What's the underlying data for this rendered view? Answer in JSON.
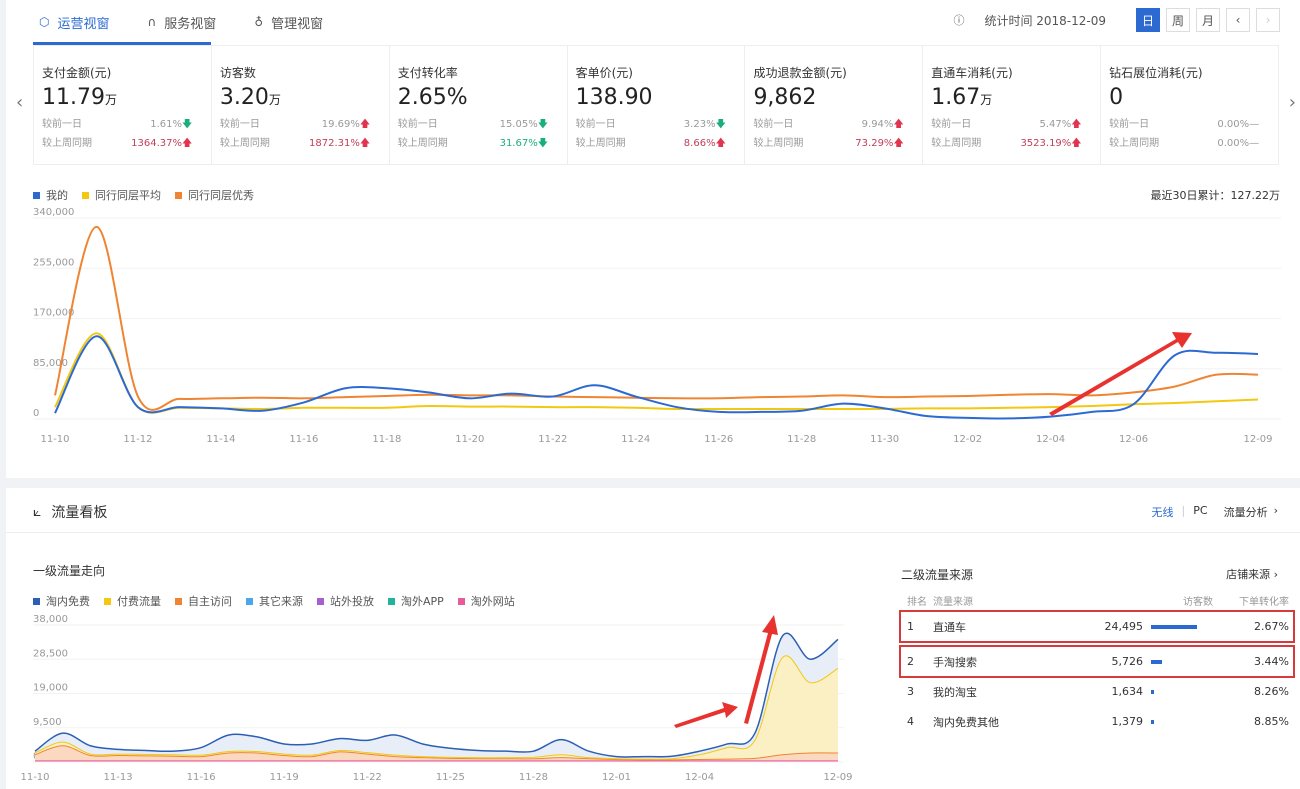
{
  "tabs": [
    {
      "label": "运营视窗",
      "icon": "shield-icon",
      "active": true
    },
    {
      "label": "服务视窗",
      "icon": "headset-icon"
    },
    {
      "label": "管理视窗",
      "icon": "medal-icon"
    }
  ],
  "header": {
    "stat_time": "统计时间 2018-12-09",
    "periods": [
      "日",
      "周",
      "月"
    ],
    "active_period": "日"
  },
  "kpis": [
    {
      "title": "支付金额(元)",
      "value": "11.79",
      "unit": "万",
      "d_label": "较前一日",
      "d_val": "1.61%",
      "d_dir": "down",
      "w_label": "较上周同期",
      "w_val": "1364.37%",
      "w_dir": "up"
    },
    {
      "title": "访客数",
      "value": "3.20",
      "unit": "万",
      "d_label": "较前一日",
      "d_val": "19.69%",
      "d_dir": "up",
      "w_label": "较上周同期",
      "w_val": "1872.31%",
      "w_dir": "up"
    },
    {
      "title": "支付转化率",
      "value": "2.65%",
      "unit": "",
      "d_label": "较前一日",
      "d_val": "15.05%",
      "d_dir": "down",
      "w_label": "较上周同期",
      "w_val": "31.67%",
      "w_dir": "down"
    },
    {
      "title": "客单价(元)",
      "value": "138.90",
      "unit": "",
      "d_label": "较前一日",
      "d_val": "3.23%",
      "d_dir": "down",
      "w_label": "较上周同期",
      "w_val": "8.66%",
      "w_dir": "up"
    },
    {
      "title": "成功退款金额(元)",
      "value": "9,862",
      "unit": "",
      "d_label": "较前一日",
      "d_val": "9.94%",
      "d_dir": "up",
      "w_label": "较上周同期",
      "w_val": "73.29%",
      "w_dir": "up"
    },
    {
      "title": "直通车消耗(元)",
      "value": "1.67",
      "unit": "万",
      "d_label": "较前一日",
      "d_val": "5.47%",
      "d_dir": "up",
      "w_label": "较上周同期",
      "w_val": "3523.19%",
      "w_dir": "up"
    },
    {
      "title": "钻石展位消耗(元)",
      "value": "0",
      "unit": "",
      "d_label": "较前一日",
      "d_val": "0.00%",
      "d_dir": "flat",
      "w_label": "较上周同期",
      "w_val": "0.00%",
      "w_dir": "flat"
    }
  ],
  "colors": {
    "accent": "#2c6ad2",
    "up": "#e0344f",
    "down": "#1aae7a",
    "annotation": "#e8322f"
  },
  "traffic": {
    "title": "流量看板",
    "links": [
      "无线",
      "PC",
      "流量分析"
    ],
    "active_link": "无线",
    "sub_left": "一级流量走向",
    "sub_right": "二级流量来源",
    "store_link": "店铺来源",
    "table_headers": [
      "排名",
      "流量来源",
      "访客数",
      "下单转化率"
    ],
    "rows": [
      {
        "rank": "1",
        "source": "直通车",
        "visitors": "24,495",
        "visitors_num": 24495,
        "rate": "2.67%",
        "highlighted": true
      },
      {
        "rank": "2",
        "source": "手淘搜索",
        "visitors": "5,726",
        "visitors_num": 5726,
        "rate": "3.44%",
        "highlighted": true
      },
      {
        "rank": "3",
        "source": "我的淘宝",
        "visitors": "1,634",
        "visitors_num": 1634,
        "rate": "8.26%"
      },
      {
        "rank": "4",
        "source": "淘内免费其他",
        "visitors": "1,379",
        "visitors_num": 1379,
        "rate": "8.85%"
      }
    ]
  },
  "chart_data": [
    {
      "type": "line",
      "total_label": "最近30日累计：127.22万",
      "ylim": [
        0,
        340000
      ],
      "yticks": [
        "0",
        "85,000",
        "170,000",
        "255,000",
        "340,000"
      ],
      "xticks": [
        "11-10",
        "11-12",
        "11-14",
        "11-16",
        "11-18",
        "11-20",
        "11-22",
        "11-24",
        "11-26",
        "11-28",
        "11-30",
        "12-02",
        "12-04",
        "12-06",
        "12-09"
      ],
      "x": [
        "11-10",
        "11-11",
        "11-12",
        "11-13",
        "11-14",
        "11-15",
        "11-16",
        "11-17",
        "11-18",
        "11-19",
        "11-20",
        "11-21",
        "11-22",
        "11-23",
        "11-24",
        "11-25",
        "11-26",
        "11-27",
        "11-28",
        "11-29",
        "11-30",
        "12-01",
        "12-02",
        "12-03",
        "12-04",
        "12-05",
        "12-06",
        "12-07",
        "12-08",
        "12-09"
      ],
      "series": [
        {
          "name": "我的",
          "color": "#2c6ad2",
          "values": [
            10000,
            140000,
            20000,
            20000,
            18000,
            14000,
            28000,
            52000,
            52000,
            45000,
            35000,
            43000,
            38000,
            57000,
            38000,
            20000,
            12000,
            12000,
            14000,
            26000,
            18000,
            5000,
            2000,
            1000,
            4000,
            12000,
            25000,
            108000,
            112000,
            110000
          ]
        },
        {
          "name": "同行同层平均",
          "color": "#f2c811",
          "values": [
            20000,
            145000,
            20000,
            19000,
            18000,
            17000,
            19000,
            19000,
            19000,
            22000,
            21000,
            21000,
            20000,
            20000,
            19000,
            17000,
            17000,
            17000,
            17000,
            17000,
            17000,
            18000,
            18000,
            19000,
            20000,
            22000,
            25000,
            27000,
            30000,
            33000
          ]
        },
        {
          "name": "同行同层优秀",
          "color": "#ef8533",
          "values": [
            40000,
            325000,
            38000,
            34000,
            35000,
            36000,
            35000,
            37000,
            39000,
            41000,
            40000,
            40000,
            38000,
            37000,
            36000,
            35000,
            35000,
            37000,
            38000,
            40000,
            37000,
            38000,
            39000,
            41000,
            42000,
            40000,
            45000,
            55000,
            75000,
            75000
          ]
        }
      ]
    },
    {
      "type": "area",
      "stacked": true,
      "title": "一级流量走向",
      "ylim": [
        0,
        38000
      ],
      "yticks": [
        "0",
        "9,500",
        "19,000",
        "28,500",
        "38,000"
      ],
      "xticks": [
        "11-10",
        "11-13",
        "11-16",
        "11-19",
        "11-22",
        "11-25",
        "11-28",
        "12-01",
        "12-04",
        "12-09"
      ],
      "series": [
        {
          "name": "淘外网站",
          "color": "#e85a9a",
          "values": [
            300,
            300,
            300,
            300,
            300,
            300,
            300,
            300,
            300,
            300,
            300,
            300,
            300,
            300,
            300,
            300,
            300,
            300,
            300,
            300,
            300,
            300,
            300,
            300,
            300,
            300,
            300,
            300,
            300,
            300
          ]
        },
        {
          "name": "自主访问",
          "color": "#ef8533",
          "values": [
            1700,
            4200,
            1500,
            1500,
            1400,
            1300,
            1200,
            2200,
            2200,
            1500,
            1200,
            2500,
            1900,
            1200,
            900,
            700,
            600,
            600,
            600,
            900,
            600,
            400,
            300,
            300,
            400,
            500,
            700,
            1700,
            2200,
            2200
          ]
        },
        {
          "name": "付费流量",
          "color": "#f2c811",
          "values": [
            500,
            1000,
            400,
            400,
            400,
            400,
            400,
            400,
            400,
            400,
            400,
            400,
            400,
            400,
            300,
            300,
            300,
            300,
            400,
            800,
            300,
            200,
            200,
            300,
            1300,
            3200,
            5000,
            27000,
            19500,
            23500
          ]
        },
        {
          "name": "淘内免费",
          "color": "#2c5fb3",
          "values": [
            500,
            2500,
            2300,
            1300,
            1100,
            1000,
            2100,
            4600,
            4100,
            2800,
            3100,
            3300,
            3400,
            5600,
            3500,
            2500,
            2000,
            1800,
            1700,
            4200,
            1800,
            600,
            700,
            700,
            1000,
            1000,
            2000,
            6000,
            6500,
            8000
          ]
        },
        {
          "name": "其它来源",
          "color": "#4aa8e8",
          "values": []
        },
        {
          "name": "站外投放",
          "color": "#a45fd0",
          "values": []
        },
        {
          "name": "淘外APP",
          "color": "#1fb59a",
          "values": []
        }
      ],
      "legend_order": [
        "淘内免费",
        "付费流量",
        "自主访问",
        "其它来源",
        "站外投放",
        "淘外APP",
        "淘外网站"
      ]
    }
  ]
}
